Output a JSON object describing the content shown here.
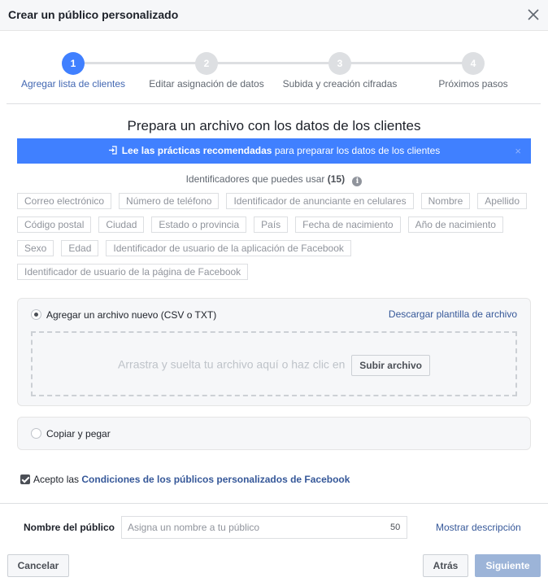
{
  "dialog": {
    "title": "Crear un público personalizado"
  },
  "stepper": {
    "steps": [
      {
        "number": "1",
        "label": "Agregar lista de clientes",
        "active": true
      },
      {
        "number": "2",
        "label": "Editar asignación de datos",
        "active": false
      },
      {
        "number": "3",
        "label": "Subida y creación cifradas",
        "active": false
      },
      {
        "number": "4",
        "label": "Próximos pasos",
        "active": false
      }
    ]
  },
  "main": {
    "title": "Prepara un archivo con los datos de los clientes",
    "banner": {
      "icon": "sign-in-icon",
      "bold_text": "Lee las prácticas recomendadas",
      "rest_text": " para preparar los datos de los clientes",
      "close": "×"
    },
    "identifiers": {
      "label": "Identificadores que puedes usar",
      "count": "(15)",
      "info": "i",
      "rows": [
        [
          "Correo electrónico",
          "Número de teléfono",
          "Identificador de anunciante en celulares",
          "Nombre",
          "Apellido"
        ],
        [
          "Código postal",
          "Ciudad",
          "Estado o provincia",
          "País",
          "Fecha de nacimiento",
          "Año de nacimiento"
        ],
        [
          "Sexo",
          "Edad",
          "Identificador de usuario de la aplicación de Facebook"
        ],
        [
          "Identificador de usuario de la página de Facebook"
        ]
      ]
    },
    "upload": {
      "option_label": "Agregar un archivo nuevo (CSV o TXT)",
      "download_link": "Descargar plantilla de archivo",
      "dropzone_text": "Arrastra y suelta tu archivo aquí o haz clic en",
      "upload_button": "Subir archivo"
    },
    "paste": {
      "option_label": "Copiar y pegar"
    },
    "terms": {
      "prefix": "Acepto las ",
      "link": "Condiciones de los públicos personalizados de Facebook"
    }
  },
  "footer": {
    "name_label": "Nombre del público",
    "name_placeholder": "Asigna un nombre a tu público",
    "char_count": "50",
    "show_description": "Mostrar descripción",
    "cancel": "Cancelar",
    "back": "Atrás",
    "next": "Siguiente"
  },
  "colors": {
    "accent": "#4080ff",
    "link": "#365899",
    "disabled_primary": "#9cb4d8"
  }
}
